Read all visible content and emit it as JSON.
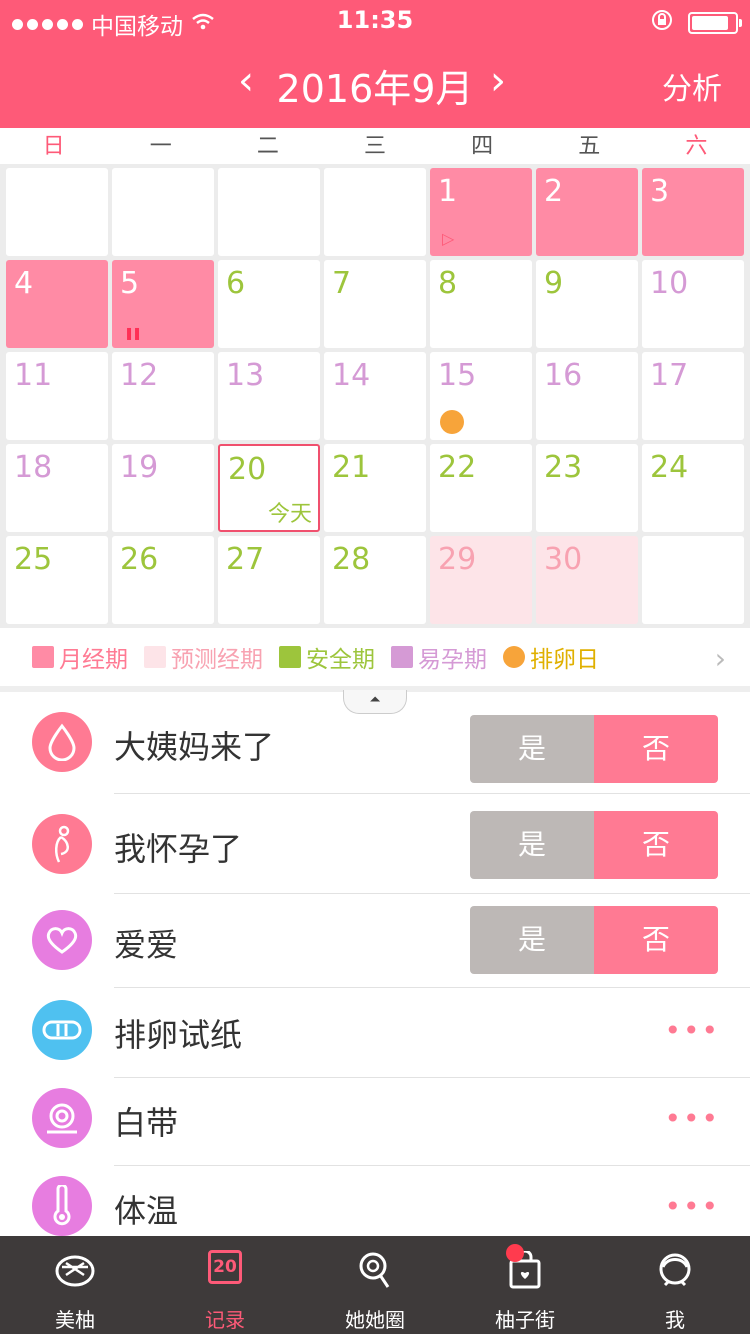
{
  "status_bar": {
    "carrier": "中国移动",
    "time": "11:35"
  },
  "header": {
    "month_title": "2016年9月",
    "prev": "‹",
    "next": "›",
    "analysis": "分析"
  },
  "weekdays": [
    "日",
    "一",
    "二",
    "三",
    "四",
    "五",
    "六"
  ],
  "calendar": {
    "days": [
      {
        "n": "1"
      },
      {
        "n": "2"
      },
      {
        "n": "3"
      },
      {
        "n": "4"
      },
      {
        "n": "5"
      },
      {
        "n": "6"
      },
      {
        "n": "7"
      },
      {
        "n": "8"
      },
      {
        "n": "9"
      },
      {
        "n": "10"
      },
      {
        "n": "11"
      },
      {
        "n": "12"
      },
      {
        "n": "13"
      },
      {
        "n": "14"
      },
      {
        "n": "15"
      },
      {
        "n": "16"
      },
      {
        "n": "17"
      },
      {
        "n": "18"
      },
      {
        "n": "19"
      },
      {
        "n": "20"
      },
      {
        "n": "21"
      },
      {
        "n": "22"
      },
      {
        "n": "23"
      },
      {
        "n": "24"
      },
      {
        "n": "25"
      },
      {
        "n": "26"
      },
      {
        "n": "27"
      },
      {
        "n": "28"
      },
      {
        "n": "29"
      },
      {
        "n": "30"
      }
    ],
    "today_label": "今天",
    "colors": {
      "period": "#ff8ba5",
      "safe": "#9dc53c",
      "fertile": "#d59ad5",
      "predicted": "#fde4e8",
      "ovulation": "#f7a43a"
    }
  },
  "legend": [
    {
      "label": "月经期",
      "color": "#ff8ba5"
    },
    {
      "label": "预测经期",
      "color": "#fde4e8"
    },
    {
      "label": "安全期",
      "color": "#9dc53c"
    },
    {
      "label": "易孕期",
      "color": "#d59ad5"
    },
    {
      "label": "排卵日",
      "color": "#f7a43a"
    }
  ],
  "records": [
    {
      "label": "大姨妈来了",
      "icon": "drop-icon",
      "yes": "是",
      "no": "否",
      "color": "#ff7a93"
    },
    {
      "label": "我怀孕了",
      "icon": "pregnant-icon",
      "yes": "是",
      "no": "否",
      "color": "#ff7a93"
    },
    {
      "label": "爱爱",
      "icon": "heart-icon",
      "yes": "是",
      "no": "否",
      "color": "#e77de0"
    },
    {
      "label": "排卵试纸",
      "icon": "test-strip-icon",
      "more": "•••",
      "color": "#4fc1f0"
    },
    {
      "label": "白带",
      "icon": "swirl-icon",
      "more": "•••",
      "color": "#e77de0"
    },
    {
      "label": "体温",
      "icon": "thermometer-icon",
      "more": "•••",
      "color": "#e77de0"
    }
  ],
  "tabs": [
    {
      "label": "美柚",
      "icon": "grapefruit-icon"
    },
    {
      "label": "记录",
      "icon": "calendar-icon",
      "icon_text": "20"
    },
    {
      "label": "她她圈",
      "icon": "lollipop-icon"
    },
    {
      "label": "柚子街",
      "icon": "shopping-bag-icon"
    },
    {
      "label": "我",
      "icon": "face-icon"
    }
  ]
}
